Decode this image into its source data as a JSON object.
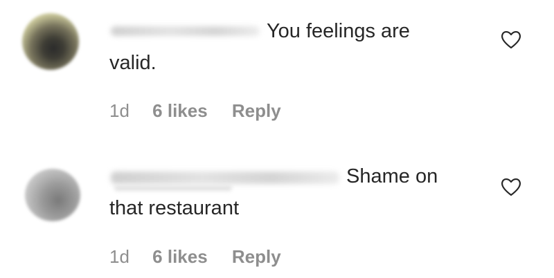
{
  "comments": [
    {
      "text_line1": "You feelings are",
      "text_line2": "valid.",
      "time": "1d",
      "likes": "6 likes",
      "reply_label": "Reply",
      "like_icon": "heart-outline-icon"
    },
    {
      "text_line1": "Shame on",
      "text_line2": "that restaurant",
      "time": "1d",
      "likes": "6 likes",
      "reply_label": "Reply",
      "like_icon": "heart-outline-icon"
    }
  ],
  "colors": {
    "text": "#262626",
    "meta": "#8e8e8e",
    "background": "#ffffff"
  }
}
